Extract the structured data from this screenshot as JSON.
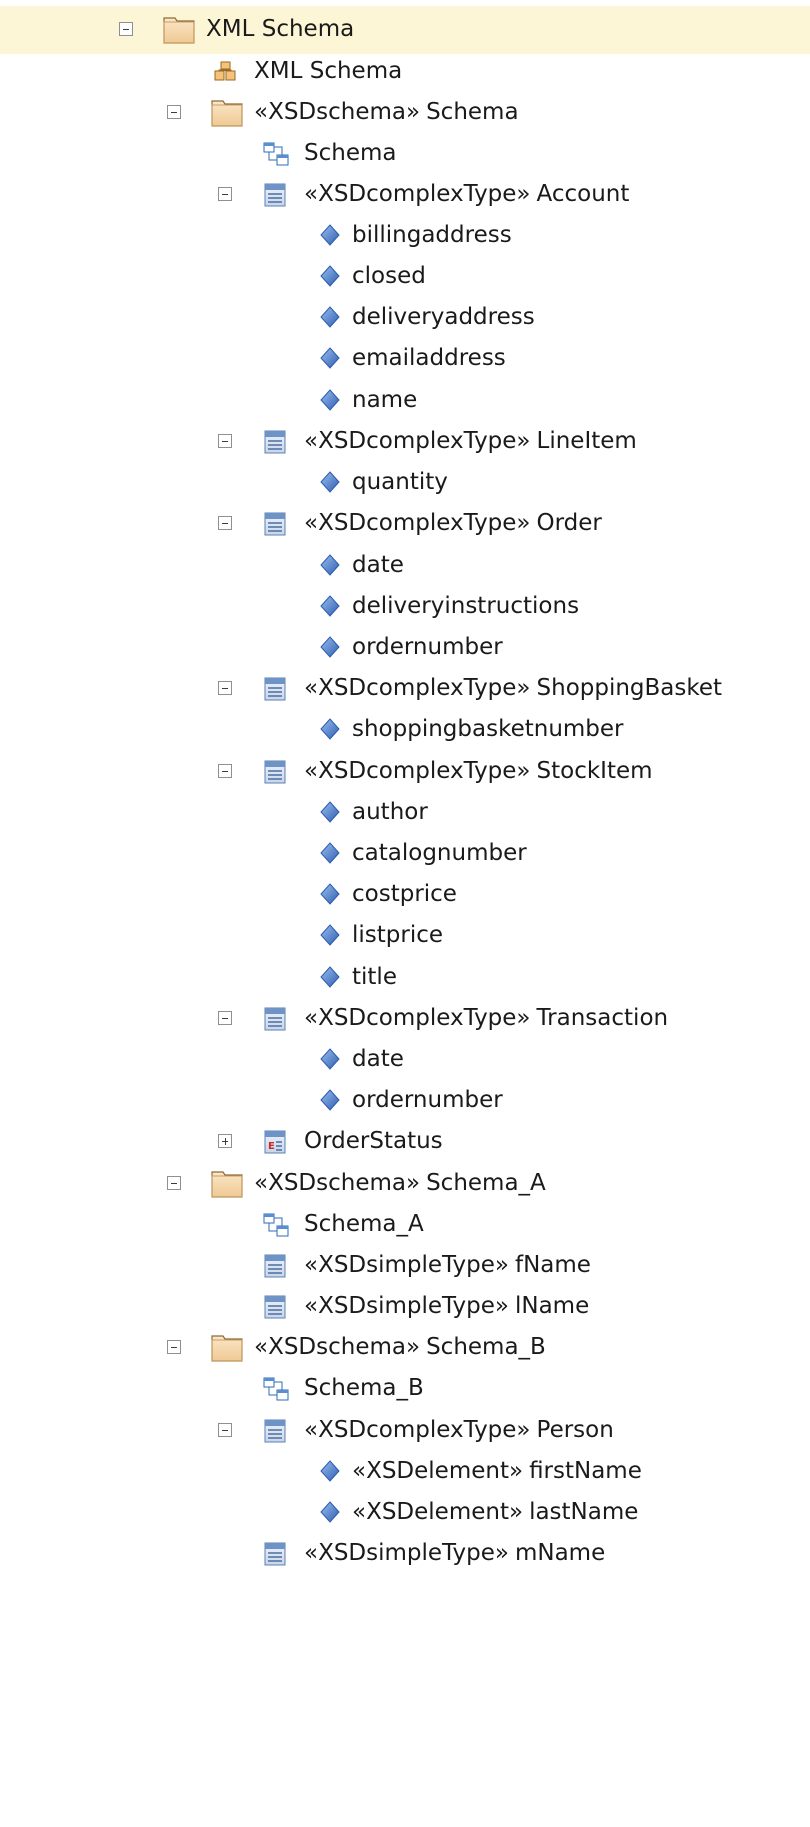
{
  "tree": {
    "root": {
      "label": "XML Schema",
      "icon": "folder-icon"
    },
    "root_diagram": {
      "label": "XML Schema",
      "icon": "package-diagram-icon"
    },
    "schema": {
      "stereotype": "«XSDschema»",
      "name": "Schema",
      "diagram": {
        "label": "Schema"
      },
      "account": {
        "stereotype": "«XSDcomplexType»",
        "name": "Account",
        "attributes": [
          "billingaddress",
          "closed",
          "deliveryaddress",
          "emailaddress",
          "name"
        ]
      },
      "lineitem": {
        "stereotype": "«XSDcomplexType»",
        "name": "LineItem",
        "attributes": [
          "quantity"
        ]
      },
      "order": {
        "stereotype": "«XSDcomplexType»",
        "name": "Order",
        "attributes": [
          "date",
          "deliveryinstructions",
          "ordernumber"
        ]
      },
      "shoppingbasket": {
        "stereotype": "«XSDcomplexType»",
        "name": "ShoppingBasket",
        "attributes": [
          "shoppingbasketnumber"
        ]
      },
      "stockitem": {
        "stereotype": "«XSDcomplexType»",
        "name": "StockItem",
        "attributes": [
          "author",
          "catalognumber",
          "costprice",
          "listprice",
          "title"
        ]
      },
      "transaction": {
        "stereotype": "«XSDcomplexType»",
        "name": "Transaction",
        "attributes": [
          "date",
          "ordernumber"
        ]
      },
      "orderstatus": {
        "name": "OrderStatus",
        "icon": "enumeration-icon"
      }
    },
    "schema_a": {
      "stereotype": "«XSDschema»",
      "name": "Schema_A",
      "diagram": {
        "label": "Schema_A"
      },
      "fname": {
        "stereotype": "«XSDsimpleType»",
        "name": "fName"
      },
      "lname": {
        "stereotype": "«XSDsimpleType»",
        "name": "lName"
      }
    },
    "schema_b": {
      "stereotype": "«XSDschema»",
      "name": "Schema_B",
      "diagram": {
        "label": "Schema_B"
      },
      "person": {
        "stereotype": "«XSDcomplexType»",
        "name": "Person",
        "elements": [
          {
            "stereotype": "«XSDelement»",
            "name": "firstName"
          },
          {
            "stereotype": "«XSDelement»",
            "name": "lastName"
          }
        ]
      },
      "mname": {
        "stereotype": "«XSDsimpleType»",
        "name": "mName"
      }
    }
  },
  "colors": {
    "selected_row": "#fcf6d6",
    "folder_fill": "#f5d9b4",
    "class_icon": "#5b7fb3",
    "attribute_icon": "#3f6fc4"
  }
}
